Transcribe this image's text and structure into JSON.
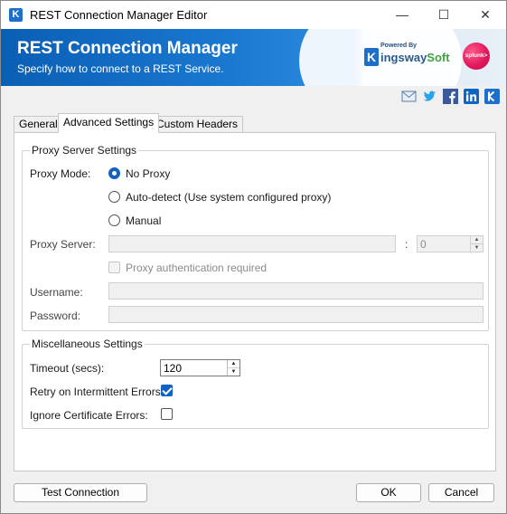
{
  "window": {
    "title": "REST Connection Manager Editor",
    "icon_letter": "K",
    "controls": {
      "minimize": "—",
      "maximize": "☐",
      "close": "✕"
    }
  },
  "banner": {
    "title": "REST Connection Manager",
    "subtitle": "Specify how to connect to a REST Service.",
    "brand_powered": "Powered By",
    "brand_k": "K",
    "brand_name_main": "ingsway",
    "brand_name_soft": "Soft",
    "partner": "splunk>"
  },
  "social_icons": [
    "email-icon",
    "twitter-icon",
    "facebook-icon",
    "linkedin-icon",
    "kingswaysoft-icon"
  ],
  "tabs": [
    {
      "label": "General",
      "active": false
    },
    {
      "label": "Advanced Settings",
      "active": true
    },
    {
      "label": "Custom Headers",
      "active": false
    }
  ],
  "proxy": {
    "group_title": "Proxy Server Settings",
    "mode_label": "Proxy Mode:",
    "options": [
      {
        "label": "No Proxy",
        "checked": true
      },
      {
        "label": "Auto-detect (Use system configured proxy)",
        "checked": false
      },
      {
        "label": "Manual",
        "checked": false
      }
    ],
    "server_label": "Proxy Server:",
    "server_value": "",
    "port_separator": ":",
    "port_value": "0",
    "auth_label": "Proxy authentication required",
    "auth_checked": false,
    "username_label": "Username:",
    "username_value": "",
    "password_label": "Password:",
    "password_value": ""
  },
  "misc": {
    "group_title": "Miscellaneous Settings",
    "timeout_label": "Timeout (secs):",
    "timeout_value": "120",
    "retry_label": "Retry on Intermittent Errors:",
    "retry_checked": true,
    "ignore_cert_label": "Ignore Certificate Errors:",
    "ignore_cert_checked": false
  },
  "buttons": {
    "test_connection": "Test Connection",
    "ok": "OK",
    "cancel": "Cancel"
  },
  "colors": {
    "accent": "#1462c0",
    "banner": "#0a5fb4"
  }
}
